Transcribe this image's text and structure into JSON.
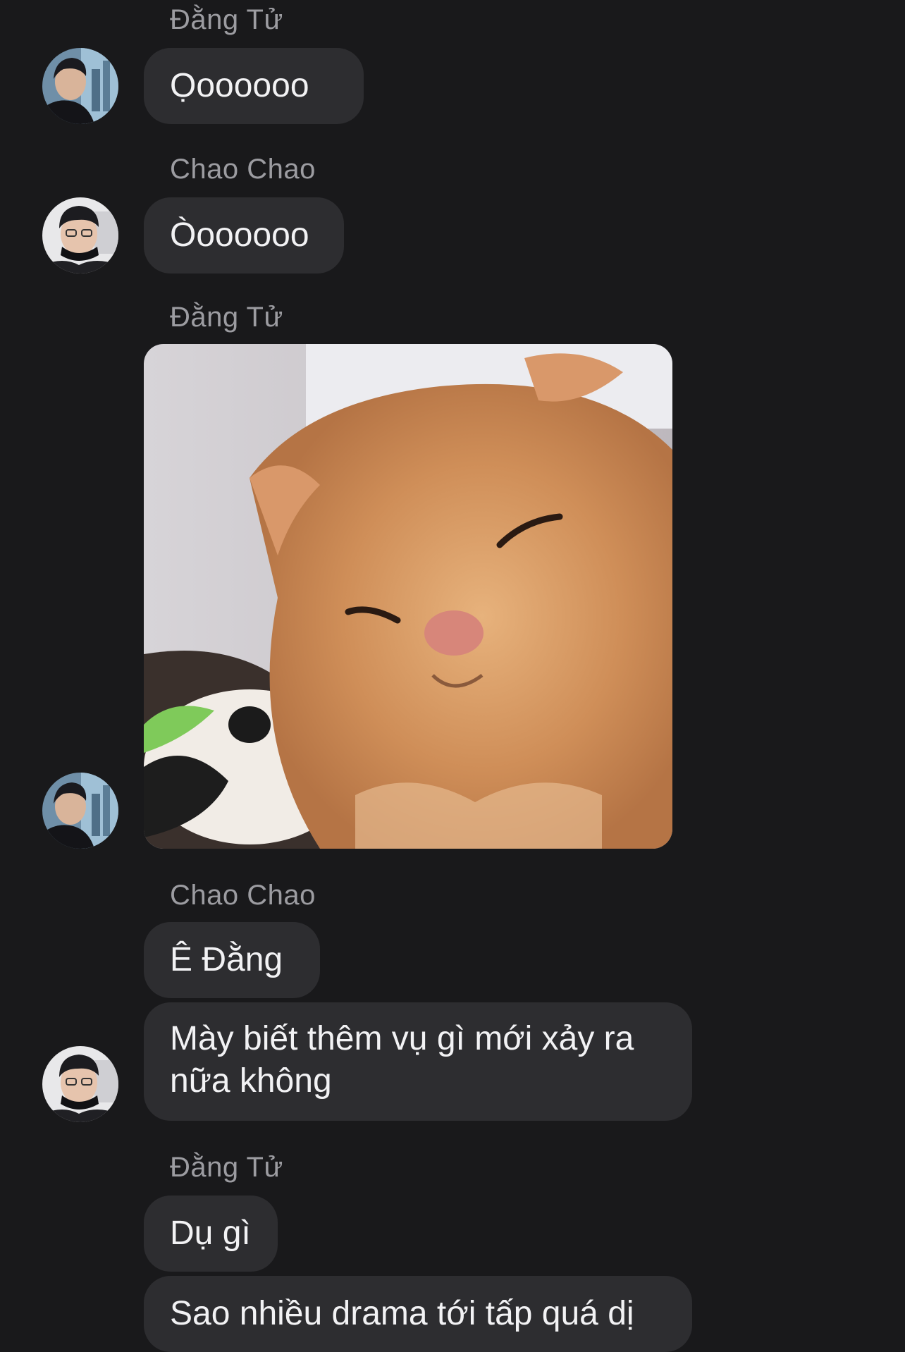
{
  "conversation": {
    "messages": [
      {
        "sender": "Đằng Tử",
        "text": "Ọoooooo"
      },
      {
        "sender": "Chao Chao",
        "text": "Òoooooo"
      },
      {
        "sender": "Đằng Tử"
      },
      {
        "sender": "Chao Chao",
        "texts": [
          "Ê Đằng",
          "Mày biết thêm vụ gì mới xảy ra nữa không"
        ]
      },
      {
        "sender": "Đằng Tử",
        "texts": [
          "Dụ gì",
          "Sao nhiều drama tới tấp quá dị"
        ]
      }
    ]
  }
}
